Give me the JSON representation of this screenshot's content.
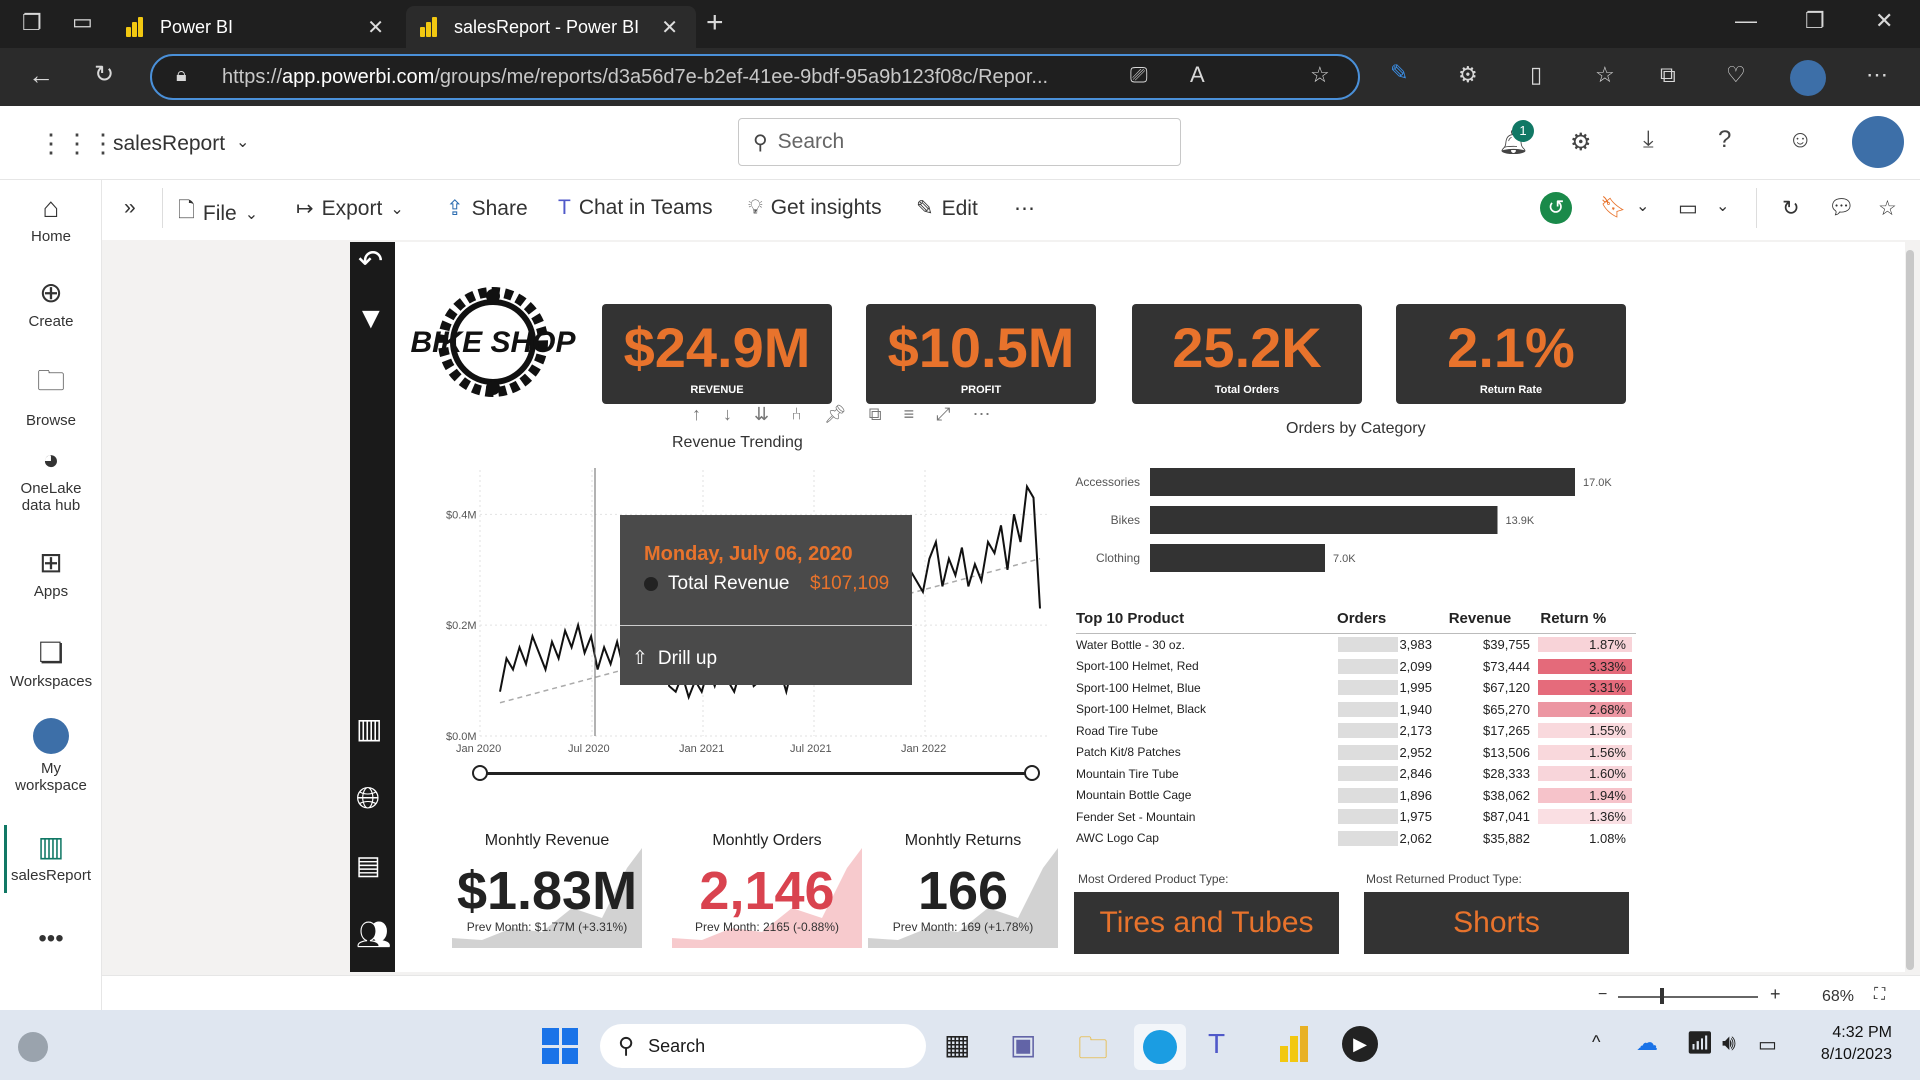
{
  "browser": {
    "tabs": [
      {
        "title": "Power BI"
      },
      {
        "title": "salesReport - Power BI"
      }
    ],
    "url_prefix": "https://",
    "url_host": "app.powerbi.com",
    "url_path": "/groups/me/reports/d3a56d7e-b2ef-41ee-9bdf-95a9b123f08c/Repor..."
  },
  "header": {
    "report_name": "salesReport",
    "search_placeholder": "Search",
    "notification_count": "1"
  },
  "leftnav": [
    {
      "label": "Home"
    },
    {
      "label": "Create"
    },
    {
      "label": "Browse"
    },
    {
      "label": "OneLake data hub"
    },
    {
      "label": "Apps"
    },
    {
      "label": "Workspaces"
    },
    {
      "label": "My workspace"
    },
    {
      "label": "salesReport"
    }
  ],
  "toolbar": {
    "file": "File",
    "export": "Export",
    "share": "Share",
    "chat": "Chat in Teams",
    "insights": "Get insights",
    "edit": "Edit"
  },
  "report": {
    "logo_text": "BIKE SHOP",
    "kpis": [
      {
        "value": "$24.9M",
        "label": "REVENUE"
      },
      {
        "value": "$10.5M",
        "label": "PROFIT"
      },
      {
        "value": "25.2K",
        "label": "Total Orders"
      },
      {
        "value": "2.1%",
        "label": "Return Rate"
      }
    ],
    "trend_title": "Revenue Trending",
    "tooltip": {
      "date": "Monday, July 06, 2020",
      "measure": "Total Revenue",
      "value": "$107,109",
      "drill": "Drill up"
    },
    "category_title": "Orders by Category",
    "table": {
      "headers": [
        "Top 10 Product",
        "Orders",
        "Revenue",
        "Return %"
      ],
      "rows": [
        [
          "Water Bottle - 30 oz.",
          "3,983",
          "$39,755",
          "1.87%"
        ],
        [
          "Sport-100 Helmet, Red",
          "2,099",
          "$73,444",
          "3.33%"
        ],
        [
          "Sport-100 Helmet, Blue",
          "1,995",
          "$67,120",
          "3.31%"
        ],
        [
          "Sport-100 Helmet, Black",
          "1,940",
          "$65,270",
          "2.68%"
        ],
        [
          "Road Tire Tube",
          "2,173",
          "$17,265",
          "1.55%"
        ],
        [
          "Patch Kit/8 Patches",
          "2,952",
          "$13,506",
          "1.56%"
        ],
        [
          "Mountain Tire Tube",
          "2,846",
          "$28,333",
          "1.60%"
        ],
        [
          "Mountain Bottle Cage",
          "1,896",
          "$38,062",
          "1.94%"
        ],
        [
          "Fender Set - Mountain",
          "1,975",
          "$87,041",
          "1.36%"
        ],
        [
          "AWC Logo Cap",
          "2,062",
          "$35,882",
          "1.08%"
        ]
      ],
      "row_fill_colors": [
        "#f8d3d8",
        "#e46a7a",
        "#e56b7b",
        "#ec96a2",
        "#f9d9dd",
        "#f9d8dc",
        "#f8d5da",
        "#f6c3ca",
        "#fadfe3",
        "#ffffff"
      ]
    },
    "monthly": [
      {
        "title": "Monhtly Revenue",
        "value": "$1.83M",
        "sub": "Prev Month: $1.77M (+3.31%)",
        "color": "#222222",
        "area": "#bfbfbf"
      },
      {
        "title": "Monhtly Orders",
        "value": "2,146",
        "sub": "Prev Month: 2165 (-0.88%)",
        "color": "#d9434f",
        "area": "#f4b3b8"
      },
      {
        "title": "Monhtly Returns",
        "value": "166",
        "sub": "Prev Month: 169 (+1.78%)",
        "color": "#222222",
        "area": "#bfbfbf"
      }
    ],
    "most_ordered_label": "Most Ordered Product Type:",
    "most_ordered_value": "Tires and Tubes",
    "most_returned_label": "Most Returned Product Type:",
    "most_returned_value": "Shorts",
    "zoom": "68%"
  },
  "chart_data": [
    {
      "type": "line",
      "title": "Revenue Trending",
      "ylabel": "",
      "yticks": [
        "$0.0M",
        "$0.2M",
        "$0.4M"
      ],
      "xticks": [
        "Jan 2020",
        "Jul 2020",
        "Jan 2021",
        "Jul 2021",
        "Jan 2022"
      ],
      "ylim": [
        0,
        0.48
      ],
      "series": [
        {
          "values": [
            0.08,
            0.14,
            0.12,
            0.16,
            0.13,
            0.18,
            0.15,
            0.12,
            0.17,
            0.14,
            0.19,
            0.16,
            0.2,
            0.15,
            0.18,
            0.12,
            0.16,
            0.13,
            0.17,
            0.12,
            0.11,
            0.1,
            0.107,
            0.12,
            0.1,
            0.14,
            0.09,
            0.08,
            0.11,
            0.07,
            0.1,
            0.08,
            0.12,
            0.09,
            0.13,
            0.1,
            0.08,
            0.12,
            0.14,
            0.09,
            0.1,
            0.13,
            0.1,
            0.12,
            0.08,
            0.13,
            0.1,
            0.14,
            0.11,
            0.13,
            0.12,
            0.15,
            0.13,
            0.18,
            0.14,
            0.17,
            0.15,
            0.2,
            0.19,
            0.22,
            0.2,
            0.24,
            0.22,
            0.3,
            0.28,
            0.26,
            0.32,
            0.35,
            0.27,
            0.32,
            0.29,
            0.34,
            0.27,
            0.31,
            0.28,
            0.35,
            0.33,
            0.38,
            0.3,
            0.4,
            0.35,
            0.45,
            0.43,
            0.23
          ]
        }
      ],
      "trend": [
        0.06,
        0.32
      ]
    },
    {
      "type": "bar",
      "title": "Orders by Category",
      "categories": [
        "Accessories",
        "Bikes",
        "Clothing"
      ],
      "values": [
        17.0,
        13.9,
        7.0
      ],
      "value_labels": [
        "17.0K",
        "13.9K",
        "7.0K"
      ]
    }
  ]
}
